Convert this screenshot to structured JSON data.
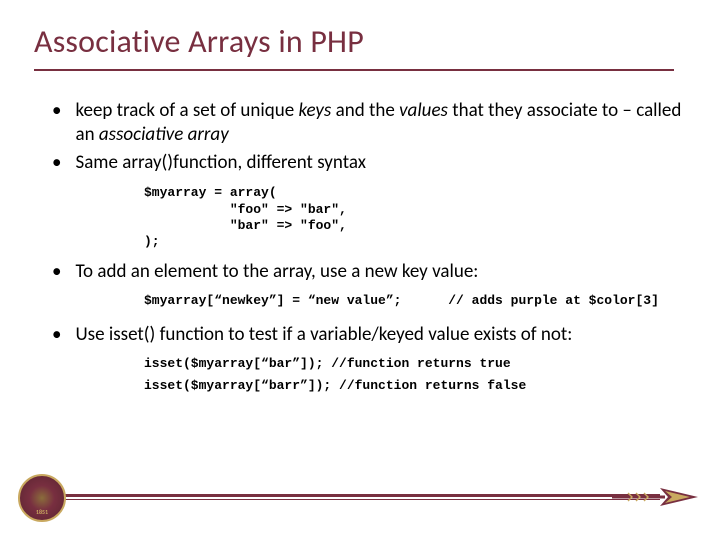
{
  "title": "Associative Arrays in PHP",
  "bullets": {
    "b1_pre": "keep track of a set of unique ",
    "b1_keys": "keys",
    "b1_mid": " and the ",
    "b1_values": "values ",
    "b1_mid2": "that they associate to – called an ",
    "b1_assoc": "associative array",
    "b2_pre": "Same ",
    "b2_fn": "array()",
    "b2_post": "function, different syntax",
    "b3": "To add an element to the array, use a new key value:",
    "b4_pre": "Use ",
    "b4_fn": "isset()",
    "b4_post": " function to test if a variable/keyed value exists of not:"
  },
  "code": {
    "arrayDef": "$myarray = array(\n           \"foo\" => \"bar\",\n           \"bar\" => \"foo\",\n);",
    "addElement": "$myarray[“newkey”] = “new value”;      // adds purple at $color[3]",
    "isset1": "isset($myarray[“bar”]); //function returns true",
    "isset2": "isset($myarray[“barr”]); //function returns false"
  }
}
